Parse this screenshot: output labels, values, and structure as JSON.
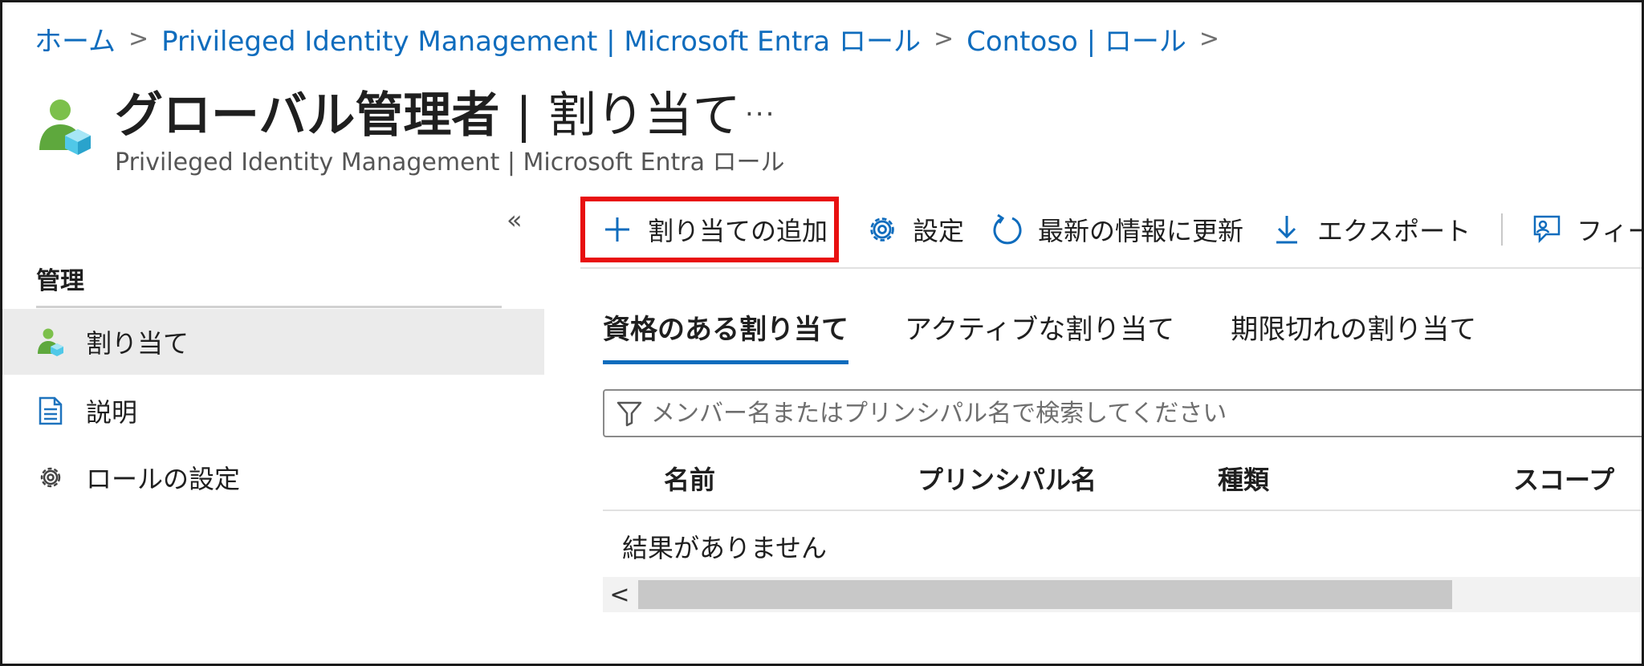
{
  "breadcrumb": {
    "items": [
      "ホーム",
      "Privileged Identity Management | Microsoft Entra ロール",
      "Contoso | ロール"
    ],
    "separator": ">"
  },
  "header": {
    "title_main": "グローバル管理者",
    "title_separator": "|",
    "title_sub": "割り当て",
    "more_label": "...",
    "subtitle": "Privileged Identity Management | Microsoft Entra ロール",
    "icon": "user-role-icon"
  },
  "sidebar": {
    "collapse_label": "«",
    "heading": "管理",
    "items": [
      {
        "label": "割り当て",
        "icon": "user-role-icon",
        "active": true
      },
      {
        "label": "説明",
        "icon": "document-icon",
        "active": false
      },
      {
        "label": "ロールの設定",
        "icon": "gear-icon",
        "active": false
      }
    ]
  },
  "toolbar": {
    "add_label": "割り当ての追加",
    "settings_label": "設定",
    "refresh_label": "最新の情報に更新",
    "export_label": "エクスポート",
    "feedback_label": "フィード"
  },
  "tabs": [
    {
      "label": "資格のある割り当て",
      "active": true
    },
    {
      "label": "アクティブな割り当て",
      "active": false
    },
    {
      "label": "期限切れの割り当て",
      "active": false
    }
  ],
  "search": {
    "value": "",
    "placeholder": "メンバー名またはプリンシパル名で検索してください"
  },
  "table": {
    "columns": [
      "名前",
      "プリンシパル名",
      "種類",
      "スコープ"
    ],
    "empty_message": "結果がありません"
  },
  "scrollbar": {
    "left_arrow": "<"
  },
  "colors": {
    "accent": "#0f6cbd",
    "highlight_box": "#e81010",
    "active_bg": "#ebebeb",
    "icon_green": "#5ea83d",
    "icon_cyan": "#50c8e8"
  }
}
